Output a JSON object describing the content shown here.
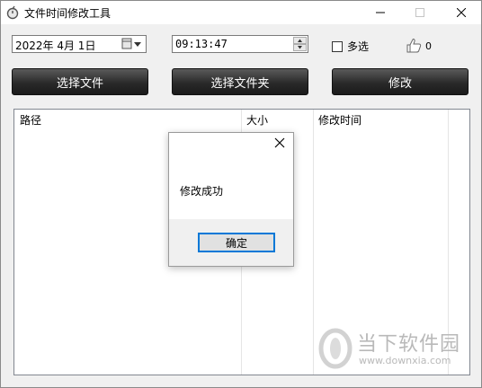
{
  "window": {
    "title": "文件时间修改工具"
  },
  "controls": {
    "date_value": "2022年  4月  1日",
    "time_value": "09:13:47",
    "multi_select_label": "多选",
    "like_count": "0"
  },
  "buttons": {
    "select_file": "选择文件",
    "select_folder": "选择文件夹",
    "modify": "修改"
  },
  "table": {
    "columns": [
      "路径",
      "大小",
      "修改时间"
    ]
  },
  "dialog": {
    "message": "修改成功",
    "ok_label": "确定"
  },
  "watermark": {
    "title": "当下软件园",
    "url": "www.downxia.com"
  }
}
